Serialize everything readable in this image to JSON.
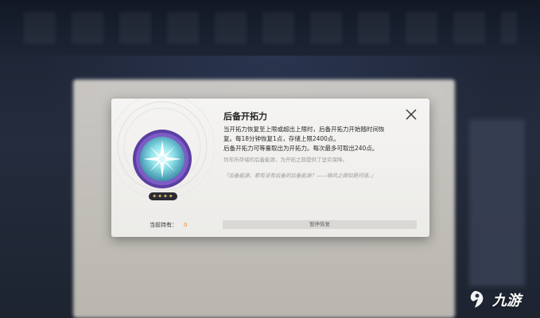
{
  "dialog": {
    "title": "后备开拓力",
    "desc_line1": "当开拓力恢复至上限或超出上限时，后备开拓力开始随时间恢",
    "desc_line2": "复。每18分钟恢复1点，存储上限2400点。",
    "desc_line3": "后备开拓力可等量取出为开拓力。每次最多可取出240点。",
    "note": "列车所存储的后备能源，为开拓之旅提供了坚实保障。",
    "quote": "「后备能源，那有没有后备的后备能源？——微风之卿如是问道。」",
    "stars": "✦✦✦✦",
    "hold_label": "当前持有：",
    "hold_count": "0",
    "pause_label": "暂停恢复",
    "item_icon": "reserve-trailblaze-power-orb",
    "close_icon": "close-x-icon"
  },
  "watermark": {
    "text": "九游",
    "logo_icon": "jiuyou-logo-icon"
  },
  "colors": {
    "accent_orange": "#e4902b",
    "orb_purple": "#6b4bb4",
    "orb_cyan": "#8fe3ea",
    "dialog_bg": "#f2f1ef"
  }
}
